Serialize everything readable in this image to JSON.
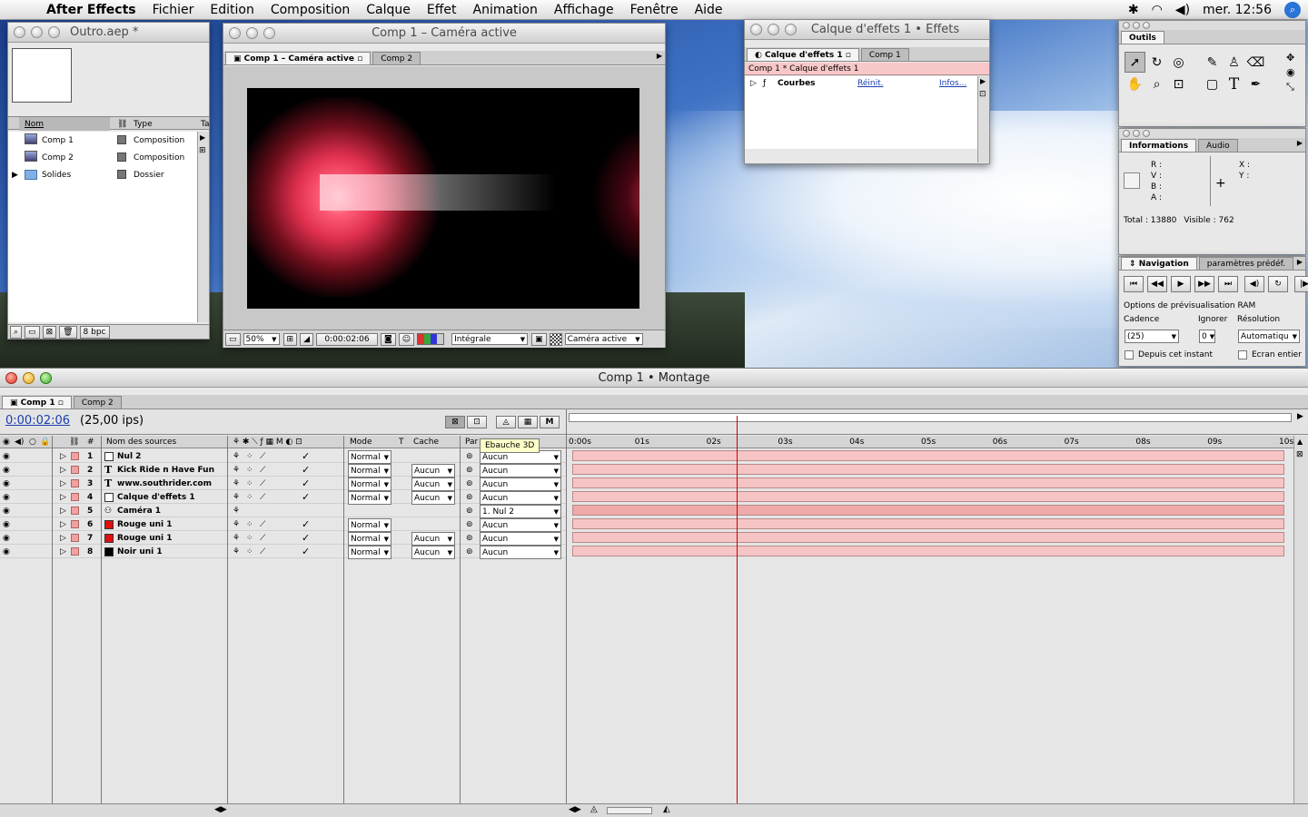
{
  "menubar": {
    "app": "After Effects",
    "items": [
      "Fichier",
      "Edition",
      "Composition",
      "Calque",
      "Effet",
      "Animation",
      "Affichage",
      "Fenêtre",
      "Aide"
    ],
    "clock": "mer. 12:56"
  },
  "project": {
    "title": "Outro.aep *",
    "headers": {
      "name": "Nom",
      "type": "Type",
      "extra": "Ta"
    },
    "rows": [
      {
        "name": "Comp 1",
        "type": "Composition"
      },
      {
        "name": "Comp 2",
        "type": "Composition"
      },
      {
        "name": "Solides",
        "type": "Dossier"
      }
    ],
    "bpc": "8 bpc"
  },
  "compwin": {
    "title": "Comp 1 – Caméra active",
    "tab_active": "Comp 1 – Caméra active",
    "tab_other": "Comp 2",
    "zoom": "50%",
    "time": "0:00:02:06",
    "resolution": "Intégrale",
    "camera": "Caméra active"
  },
  "effects": {
    "title": "Calque d'effets 1 • Effets",
    "tab_active": "Calque d'effets 1",
    "tab_other": "Comp 1",
    "breadcrumb": "Comp 1 * Calque d'effets 1",
    "effect_name": "Courbes",
    "reset": "Réinit.",
    "about": "Infos..."
  },
  "tools": {
    "title": "Outils"
  },
  "info": {
    "tab_active": "Informations",
    "tab_other": "Audio",
    "r": "R :",
    "v": "V :",
    "b": "B :",
    "a": "A :",
    "x": "X :",
    "y": "Y :",
    "total": "Total : 13880",
    "visible": "Visible : 762"
  },
  "nav": {
    "tab_active": "Navigation",
    "tab_other": "paramètres prédéf.",
    "ram_title": "Options de prévisualisation RAM",
    "cadence_label": "Cadence",
    "ignore_label": "Ignorer",
    "resolution_label": "Résolution",
    "cadence_value": "(25)",
    "ignore_value": "0",
    "resolution_value": "Automatiqu",
    "from_here": "Depuis cet instant",
    "fullscreen": "Ecran entier"
  },
  "timeline": {
    "title": "Comp 1 • Montage",
    "tab_active": "Comp 1",
    "tab_other": "Comp 2",
    "timecode": "0:00:02:06",
    "fps": "(25,00 ips)",
    "tooltip": "Ebauche 3D",
    "headers": {
      "hash": "#",
      "source": "Nom des sources",
      "mode": "Mode",
      "t": "T",
      "cache": "Cache",
      "parent": "Par"
    },
    "ruler": [
      "0:00s",
      "01s",
      "02s",
      "03s",
      "04s",
      "05s",
      "06s",
      "07s",
      "08s",
      "09s",
      "10s"
    ],
    "current_time_fraction": 0.232,
    "layers": [
      {
        "num": "1",
        "name": "Nul 2",
        "swatch": "#ffffff",
        "mode": "Normal",
        "cache": "",
        "parent": "Aucun"
      },
      {
        "num": "2",
        "name": "Kick Ride n Have Fun",
        "swatch": "text",
        "mode": "Normal",
        "cache": "Aucun",
        "parent": "Aucun"
      },
      {
        "num": "3",
        "name": "www.southrider.com",
        "swatch": "text",
        "mode": "Normal",
        "cache": "Aucun",
        "parent": "Aucun"
      },
      {
        "num": "4",
        "name": "Calque d'effets 1",
        "swatch": "#ffffff",
        "mode": "Normal",
        "cache": "Aucun",
        "parent": "Aucun"
      },
      {
        "num": "5",
        "name": "Caméra 1",
        "swatch": "camera",
        "mode": "",
        "cache": "",
        "parent": "1. Nul 2"
      },
      {
        "num": "6",
        "name": "Rouge uni 1",
        "swatch": "#e01010",
        "mode": "Normal",
        "cache": "",
        "parent": "Aucun"
      },
      {
        "num": "7",
        "name": "Rouge uni 1",
        "swatch": "#e01010",
        "mode": "Normal",
        "cache": "Aucun",
        "parent": "Aucun"
      },
      {
        "num": "8",
        "name": "Noir uni 1",
        "swatch": "#000000",
        "mode": "Normal",
        "cache": "Aucun",
        "parent": "Aucun"
      }
    ]
  },
  "colors": {
    "label": "#f2a0a0",
    "bar": "#f6c4c4",
    "cam_bar": "#efa9a9",
    "playhead": "#cc0000",
    "timecode": "#1a3fb0"
  }
}
